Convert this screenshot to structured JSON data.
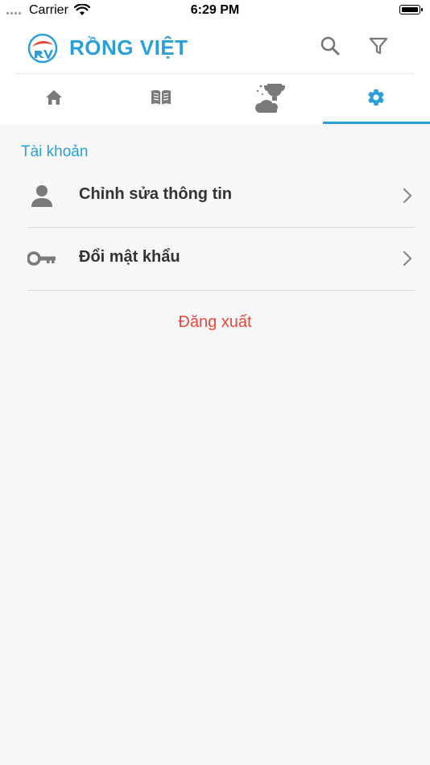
{
  "status_bar": {
    "carrier": "Carrier",
    "time": "6:29 PM"
  },
  "header": {
    "brand": "RỒNG VIỆT",
    "brand_color": "#2a9fd8",
    "actions": [
      {
        "icon": "search-icon"
      },
      {
        "icon": "filter-icon"
      }
    ]
  },
  "tabs": [
    {
      "icon": "home-icon",
      "active": false
    },
    {
      "icon": "book-icon",
      "active": false
    },
    {
      "icon": "trophy-icon",
      "active": false
    },
    {
      "icon": "gear-icon",
      "active": true
    }
  ],
  "account": {
    "section_title": "Tài khoản",
    "items": [
      {
        "label": "Chỉnh sửa thông tin",
        "icon": "person-icon"
      },
      {
        "label": "Đổi mật khẩu",
        "icon": "key-icon"
      }
    ],
    "logout_label": "Đăng xuất",
    "logout_color": "#e8473c"
  }
}
